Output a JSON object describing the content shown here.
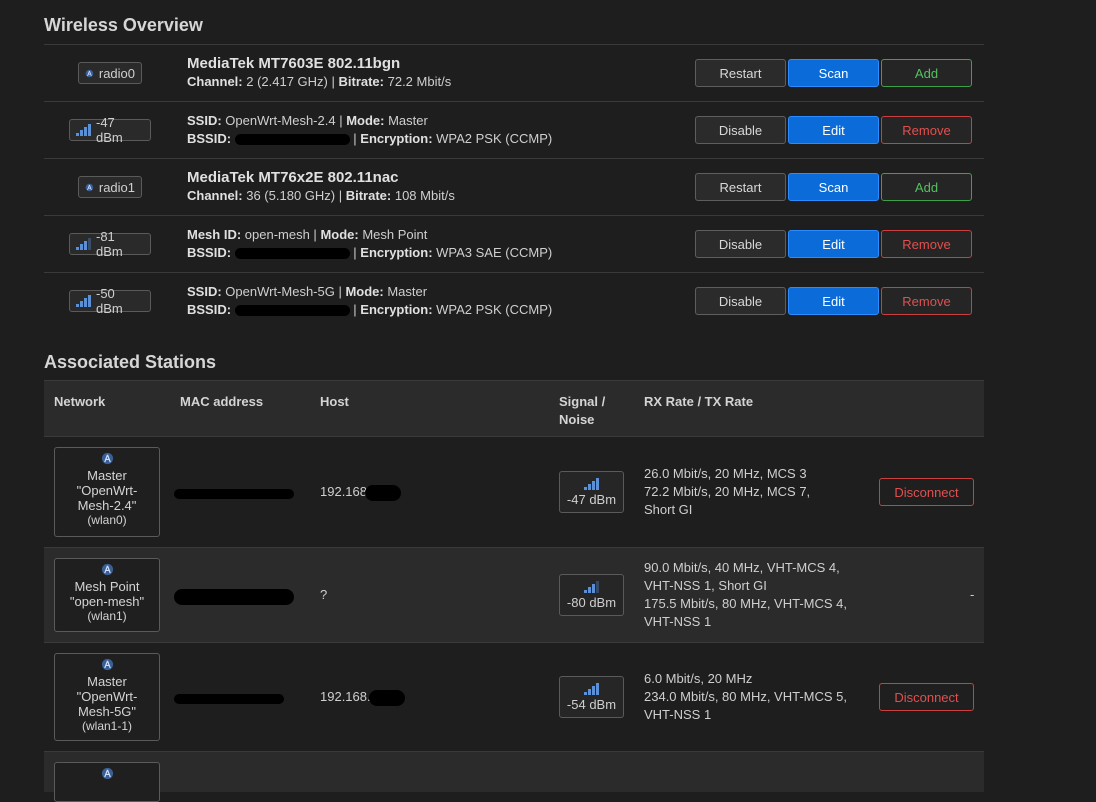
{
  "wireless_overview": {
    "title": "Wireless Overview",
    "rows": [
      {
        "kind": "radio",
        "badge": "radio0",
        "name": "MediaTek MT7603E 802.11bgn",
        "l1_label": "Channel:",
        "l1_value": " 2 (2.417 GHz) | ",
        "l1_label2": "Bitrate:",
        "l1_value2": " 72.2 Mbit/s",
        "buttons": [
          "Restart",
          "Scan",
          "Add"
        ]
      },
      {
        "kind": "net",
        "badge": "-47 dBm",
        "signal_bars": 4,
        "l1_label": "SSID:",
        "l1_value": " OpenWrt-Mesh-2.4 | ",
        "l1_label2": "Mode:",
        "l1_value2": " Master",
        "l2_label": "BSSID:",
        "l2_label2": "Encryption:",
        "l2_value2": " WPA2 PSK (CCMP)",
        "buttons": [
          "Disable",
          "Edit",
          "Remove"
        ]
      },
      {
        "kind": "radio",
        "badge": "radio1",
        "name": "MediaTek MT76x2E 802.11nac",
        "l1_label": "Channel:",
        "l1_value": " 36 (5.180 GHz) | ",
        "l1_label2": "Bitrate:",
        "l1_value2": " 108 Mbit/s",
        "buttons": [
          "Restart",
          "Scan",
          "Add"
        ]
      },
      {
        "kind": "net",
        "badge": "-81 dBm",
        "signal_bars": 3,
        "l1_label": "Mesh ID:",
        "l1_value": " open-mesh | ",
        "l1_label2": "Mode:",
        "l1_value2": " Mesh Point",
        "l2_label": "BSSID:",
        "l2_label2": "Encryption:",
        "l2_value2": " WPA3 SAE (CCMP)",
        "buttons": [
          "Disable",
          "Edit",
          "Remove"
        ]
      },
      {
        "kind": "net",
        "badge": "-50 dBm",
        "signal_bars": 4,
        "l1_label": "SSID:",
        "l1_value": " OpenWrt-Mesh-5G | ",
        "l1_label2": "Mode:",
        "l1_value2": " Master",
        "l2_label": "BSSID:",
        "l2_label2": "Encryption:",
        "l2_value2": " WPA2 PSK (CCMP)",
        "buttons": [
          "Disable",
          "Edit",
          "Remove"
        ]
      }
    ]
  },
  "associated_stations": {
    "title": "Associated Stations",
    "headers": {
      "network": "Network",
      "mac": "MAC address",
      "host": "Host",
      "signal_l1": "Signal /",
      "signal_l2": "Noise",
      "rates": "RX Rate / TX Rate"
    },
    "rows": [
      {
        "net_l1": "Master",
        "net_l2": "\"OpenWrt-",
        "net_l3": "Mesh-2.4\"",
        "net_l4": "(wlan0)",
        "host": "192.168",
        "signal": "-47 dBm",
        "signal_bars": 4,
        "rate1": "26.0 Mbit/s, 20 MHz, MCS 3",
        "rate2": "72.2 Mbit/s, 20 MHz, MCS 7,",
        "rate3": "Short GI",
        "rate4": "",
        "action": "Disconnect"
      },
      {
        "net_l1": "Mesh Point",
        "net_l2": "\"open-mesh\"",
        "net_l3": "",
        "net_l4": "(wlan1)",
        "host": "?",
        "signal": "-80 dBm",
        "signal_bars": 3,
        "rate1": "90.0 Mbit/s, 40 MHz, VHT-MCS 4,",
        "rate2": "VHT-NSS 1, Short GI",
        "rate3": "175.5 Mbit/s, 80 MHz, VHT-MCS 4,",
        "rate4": "VHT-NSS 1",
        "action": "-"
      },
      {
        "net_l1": "Master",
        "net_l2": "\"OpenWrt-",
        "net_l3": "Mesh-5G\"",
        "net_l4": "(wlan1-1)",
        "host": "192.168.",
        "signal": "-54 dBm",
        "signal_bars": 4,
        "rate1": "6.0 Mbit/s, 20 MHz",
        "rate2": "234.0 Mbit/s, 80 MHz, VHT-MCS 5,",
        "rate3": "VHT-NSS 1",
        "rate4": "",
        "action": "Disconnect"
      }
    ]
  }
}
